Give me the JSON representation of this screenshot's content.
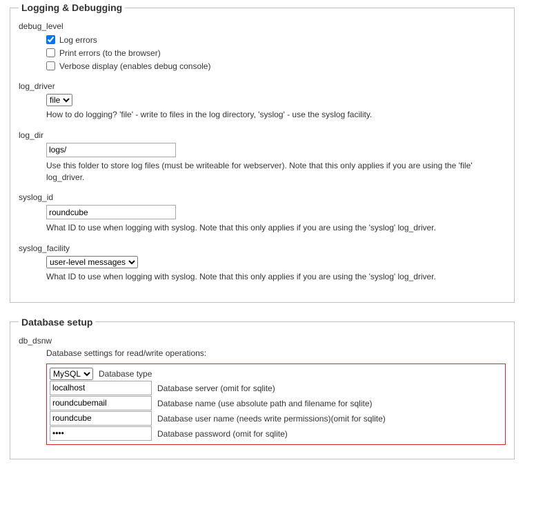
{
  "logging": {
    "legend": "Logging & Debugging",
    "debug_level": {
      "label": "debug_level",
      "options": {
        "log_errors": {
          "text": "Log errors",
          "checked": true
        },
        "print_errors": {
          "text": "Print errors (to the browser)",
          "checked": false
        },
        "verbose": {
          "text": "Verbose display (enables debug console)",
          "checked": false
        }
      }
    },
    "log_driver": {
      "label": "log_driver",
      "value": "file",
      "desc": "How to do logging? 'file' - write to files in the log directory, 'syslog' - use the syslog facility."
    },
    "log_dir": {
      "label": "log_dir",
      "value": "logs/",
      "desc": "Use this folder to store log files (must be writeable for webserver). Note that this only applies if you are using the 'file' log_driver."
    },
    "syslog_id": {
      "label": "syslog_id",
      "value": "roundcube",
      "desc": "What ID to use when logging with syslog. Note that this only applies if you are using the 'syslog' log_driver."
    },
    "syslog_facility": {
      "label": "syslog_facility",
      "value": "user-level messages",
      "desc": "What ID to use when logging with syslog. Note that this only applies if you are using the 'syslog' log_driver."
    }
  },
  "database": {
    "legend": "Database setup",
    "label": "db_dsnw",
    "intro": "Database settings for read/write operations:",
    "rows": {
      "type": {
        "value": "MySQL",
        "desc": "Database type"
      },
      "server": {
        "value": "localhost",
        "desc": "Database server (omit for sqlite)"
      },
      "name": {
        "value": "roundcubemail",
        "desc": "Database name (use absolute path and filename for sqlite)"
      },
      "user": {
        "value": "roundcube",
        "desc": "Database user name (needs write permissions)(omit for sqlite)"
      },
      "pass": {
        "value": "••••",
        "desc": "Database password (omit for sqlite)"
      }
    }
  }
}
